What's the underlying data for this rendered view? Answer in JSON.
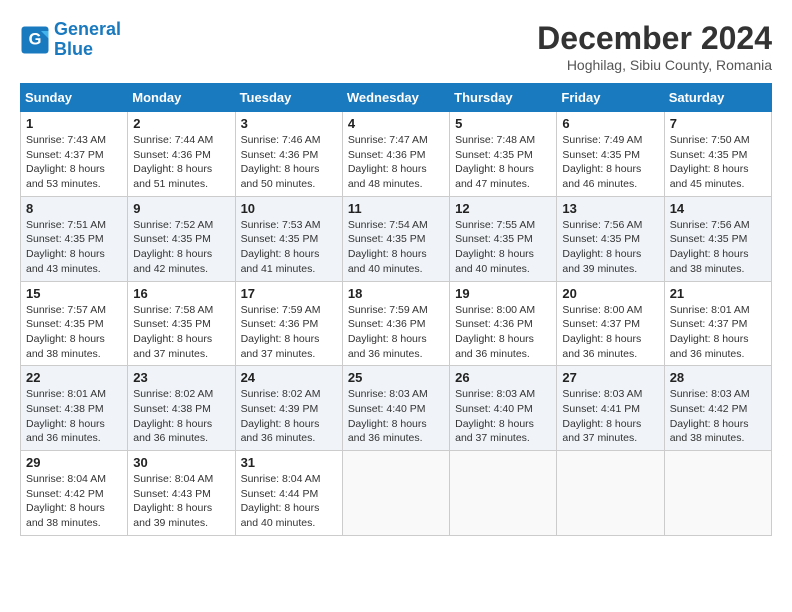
{
  "header": {
    "logo_line1": "General",
    "logo_line2": "Blue",
    "month": "December 2024",
    "location": "Hoghilag, Sibiu County, Romania"
  },
  "days_of_week": [
    "Sunday",
    "Monday",
    "Tuesday",
    "Wednesday",
    "Thursday",
    "Friday",
    "Saturday"
  ],
  "weeks": [
    [
      {
        "day": "1",
        "info": "Sunrise: 7:43 AM\nSunset: 4:37 PM\nDaylight: 8 hours\nand 53 minutes."
      },
      {
        "day": "2",
        "info": "Sunrise: 7:44 AM\nSunset: 4:36 PM\nDaylight: 8 hours\nand 51 minutes."
      },
      {
        "day": "3",
        "info": "Sunrise: 7:46 AM\nSunset: 4:36 PM\nDaylight: 8 hours\nand 50 minutes."
      },
      {
        "day": "4",
        "info": "Sunrise: 7:47 AM\nSunset: 4:36 PM\nDaylight: 8 hours\nand 48 minutes."
      },
      {
        "day": "5",
        "info": "Sunrise: 7:48 AM\nSunset: 4:35 PM\nDaylight: 8 hours\nand 47 minutes."
      },
      {
        "day": "6",
        "info": "Sunrise: 7:49 AM\nSunset: 4:35 PM\nDaylight: 8 hours\nand 46 minutes."
      },
      {
        "day": "7",
        "info": "Sunrise: 7:50 AM\nSunset: 4:35 PM\nDaylight: 8 hours\nand 45 minutes."
      }
    ],
    [
      {
        "day": "8",
        "info": "Sunrise: 7:51 AM\nSunset: 4:35 PM\nDaylight: 8 hours\nand 43 minutes."
      },
      {
        "day": "9",
        "info": "Sunrise: 7:52 AM\nSunset: 4:35 PM\nDaylight: 8 hours\nand 42 minutes."
      },
      {
        "day": "10",
        "info": "Sunrise: 7:53 AM\nSunset: 4:35 PM\nDaylight: 8 hours\nand 41 minutes."
      },
      {
        "day": "11",
        "info": "Sunrise: 7:54 AM\nSunset: 4:35 PM\nDaylight: 8 hours\nand 40 minutes."
      },
      {
        "day": "12",
        "info": "Sunrise: 7:55 AM\nSunset: 4:35 PM\nDaylight: 8 hours\nand 40 minutes."
      },
      {
        "day": "13",
        "info": "Sunrise: 7:56 AM\nSunset: 4:35 PM\nDaylight: 8 hours\nand 39 minutes."
      },
      {
        "day": "14",
        "info": "Sunrise: 7:56 AM\nSunset: 4:35 PM\nDaylight: 8 hours\nand 38 minutes."
      }
    ],
    [
      {
        "day": "15",
        "info": "Sunrise: 7:57 AM\nSunset: 4:35 PM\nDaylight: 8 hours\nand 38 minutes."
      },
      {
        "day": "16",
        "info": "Sunrise: 7:58 AM\nSunset: 4:35 PM\nDaylight: 8 hours\nand 37 minutes."
      },
      {
        "day": "17",
        "info": "Sunrise: 7:59 AM\nSunset: 4:36 PM\nDaylight: 8 hours\nand 37 minutes."
      },
      {
        "day": "18",
        "info": "Sunrise: 7:59 AM\nSunset: 4:36 PM\nDaylight: 8 hours\nand 36 minutes."
      },
      {
        "day": "19",
        "info": "Sunrise: 8:00 AM\nSunset: 4:36 PM\nDaylight: 8 hours\nand 36 minutes."
      },
      {
        "day": "20",
        "info": "Sunrise: 8:00 AM\nSunset: 4:37 PM\nDaylight: 8 hours\nand 36 minutes."
      },
      {
        "day": "21",
        "info": "Sunrise: 8:01 AM\nSunset: 4:37 PM\nDaylight: 8 hours\nand 36 minutes."
      }
    ],
    [
      {
        "day": "22",
        "info": "Sunrise: 8:01 AM\nSunset: 4:38 PM\nDaylight: 8 hours\nand 36 minutes."
      },
      {
        "day": "23",
        "info": "Sunrise: 8:02 AM\nSunset: 4:38 PM\nDaylight: 8 hours\nand 36 minutes."
      },
      {
        "day": "24",
        "info": "Sunrise: 8:02 AM\nSunset: 4:39 PM\nDaylight: 8 hours\nand 36 minutes."
      },
      {
        "day": "25",
        "info": "Sunrise: 8:03 AM\nSunset: 4:40 PM\nDaylight: 8 hours\nand 36 minutes."
      },
      {
        "day": "26",
        "info": "Sunrise: 8:03 AM\nSunset: 4:40 PM\nDaylight: 8 hours\nand 37 minutes."
      },
      {
        "day": "27",
        "info": "Sunrise: 8:03 AM\nSunset: 4:41 PM\nDaylight: 8 hours\nand 37 minutes."
      },
      {
        "day": "28",
        "info": "Sunrise: 8:03 AM\nSunset: 4:42 PM\nDaylight: 8 hours\nand 38 minutes."
      }
    ],
    [
      {
        "day": "29",
        "info": "Sunrise: 8:04 AM\nSunset: 4:42 PM\nDaylight: 8 hours\nand 38 minutes."
      },
      {
        "day": "30",
        "info": "Sunrise: 8:04 AM\nSunset: 4:43 PM\nDaylight: 8 hours\nand 39 minutes."
      },
      {
        "day": "31",
        "info": "Sunrise: 8:04 AM\nSunset: 4:44 PM\nDaylight: 8 hours\nand 40 minutes."
      },
      {
        "day": "",
        "info": ""
      },
      {
        "day": "",
        "info": ""
      },
      {
        "day": "",
        "info": ""
      },
      {
        "day": "",
        "info": ""
      }
    ]
  ]
}
